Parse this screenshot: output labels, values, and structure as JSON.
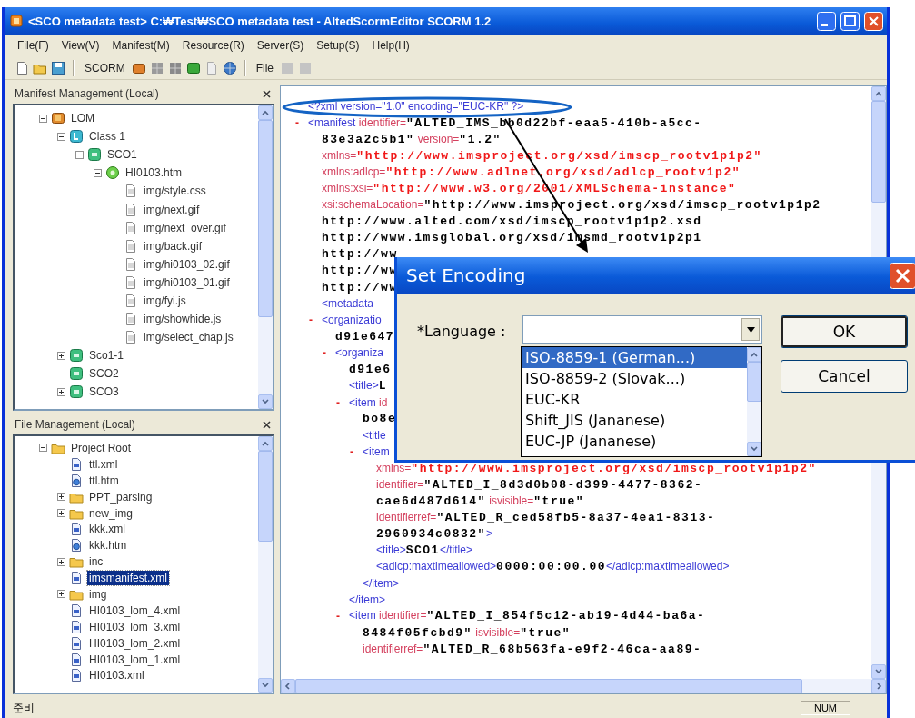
{
  "window": {
    "title": "<SCO metadata test> C:₩Test₩SCO metadata test - AltedScormEditor SCORM 1.2"
  },
  "menu": [
    "File(F)",
    "View(V)",
    "Manifest(M)",
    "Resource(R)",
    "Server(S)",
    "Setup(S)",
    "Help(H)"
  ],
  "toolbar": {
    "labels": [
      "SCORM",
      "File"
    ]
  },
  "manifest_tree": {
    "title": "Manifest Management (Local)",
    "items": [
      {
        "label": "LOM",
        "kind": "root",
        "expanded": true,
        "selected": false,
        "children": [
          {
            "label": "Class 1",
            "kind": "organization",
            "expanded": true,
            "selected": false,
            "children": [
              {
                "label": "SCO1",
                "kind": "sco",
                "expanded": true,
                "selected": false,
                "children": [
                  {
                    "label": "HI0103.htm",
                    "kind": "resource",
                    "expanded": true,
                    "selected": false,
                    "children": [
                      {
                        "label": "img/style.css",
                        "kind": "file",
                        "selected": false
                      },
                      {
                        "label": "img/next.gif",
                        "kind": "file",
                        "selected": false
                      },
                      {
                        "label": "img/next_over.gif",
                        "kind": "file",
                        "selected": false
                      },
                      {
                        "label": "img/back.gif",
                        "kind": "file",
                        "selected": false
                      },
                      {
                        "label": "img/hi0103_02.gif",
                        "kind": "file",
                        "selected": false
                      },
                      {
                        "label": "img/hi0103_01.gif",
                        "kind": "file",
                        "selected": false
                      },
                      {
                        "label": "img/fyi.js",
                        "kind": "file",
                        "selected": false
                      },
                      {
                        "label": "img/showhide.js",
                        "kind": "file",
                        "selected": false
                      },
                      {
                        "label": "img/select_chap.js",
                        "kind": "file",
                        "selected": false
                      }
                    ]
                  }
                ]
              }
            ]
          },
          {
            "label": "Sco1-1",
            "kind": "sco",
            "expanded": false,
            "selected": false
          },
          {
            "label": "SCO2",
            "kind": "sco",
            "selected": false
          },
          {
            "label": "SCO3",
            "kind": "sco",
            "expanded": false,
            "selected": false
          }
        ]
      }
    ]
  },
  "file_tree": {
    "title": "File Management (Local)",
    "items": [
      {
        "label": "Project Root",
        "kind": "folder",
        "expanded": true,
        "selected": false,
        "children": [
          {
            "label": "ttl.xml",
            "kind": "xml-file",
            "selected": false
          },
          {
            "label": "ttl.htm",
            "kind": "htm-file",
            "selected": false
          },
          {
            "label": "PPT_parsing",
            "kind": "folder",
            "expanded": false,
            "selected": false
          },
          {
            "label": "new_img",
            "kind": "folder",
            "expanded": false,
            "selected": false
          },
          {
            "label": "kkk.xml",
            "kind": "xml-file",
            "selected": false
          },
          {
            "label": "kkk.htm",
            "kind": "htm-file",
            "selected": false
          },
          {
            "label": "inc",
            "kind": "folder",
            "expanded": false,
            "selected": false
          },
          {
            "label": "imsmanifest.xml",
            "kind": "xml-file",
            "selected": true
          },
          {
            "label": "img",
            "kind": "folder",
            "expanded": false,
            "selected": false
          },
          {
            "label": "HI0103_lom_4.xml",
            "kind": "xml-file",
            "selected": false
          },
          {
            "label": "HI0103_lom_3.xml",
            "kind": "xml-file",
            "selected": false
          },
          {
            "label": "HI0103_lom_2.xml",
            "kind": "xml-file",
            "selected": false
          },
          {
            "label": "HI0103_lom_1.xml",
            "kind": "xml-file",
            "selected": false
          },
          {
            "label": "HI0103.xml",
            "kind": "xml-file",
            "selected": false
          }
        ]
      }
    ]
  },
  "editor": {
    "lines": [
      {
        "tokens": [
          {
            "kind": "tag",
            "text": "<?xml version=\"1.0\" encoding=\"EUC-KR\" ?>"
          }
        ]
      },
      {
        "marker": "-",
        "tokens": [
          {
            "kind": "tag",
            "text": "<manifest"
          },
          {
            "kind": "attr",
            "text": " identifier="
          },
          {
            "kind": "value",
            "text": "\"ALTED_IMS_bb0d22bf-eaa5-410b-a5cc-"
          }
        ],
        "children": [
          {
            "tokens": [
              {
                "kind": "value",
                "text": "83e3a2c5b1\""
              },
              {
                "kind": "attr",
                "text": " version="
              },
              {
                "kind": "value",
                "text": "\"1.2\""
              }
            ]
          },
          {
            "tokens": [
              {
                "kind": "attr",
                "text": "xmlns="
              },
              {
                "kind": "url",
                "text": "\"http://www.imsproject.org/xsd/imscp_rootv1p1p2\""
              }
            ]
          },
          {
            "tokens": [
              {
                "kind": "attr",
                "text": "xmlns:adlcp="
              },
              {
                "kind": "url",
                "text": "\"http://www.adlnet.org/xsd/adlcp_rootv1p2\""
              }
            ]
          },
          {
            "tokens": [
              {
                "kind": "attr",
                "text": "xmlns:xsi="
              },
              {
                "kind": "url",
                "text": "\"http://www.w3.org/2001/XMLSchema-instance\""
              }
            ]
          },
          {
            "tokens": [
              {
                "kind": "attr",
                "text": "xsi:schemaLocation="
              },
              {
                "kind": "value",
                "text": "\"http://www.imsproject.org/xsd/imscp_rootv1p1p2"
              }
            ]
          },
          {
            "tokens": [
              {
                "kind": "value",
                "text": "http://www.alted.com/xsd/imscp_rootv1p1p2.xsd"
              }
            ]
          },
          {
            "tokens": [
              {
                "kind": "value",
                "text": "http://www.imsglobal.org/xsd/imsmd_rootv1p2p1"
              }
            ]
          },
          {
            "tokens": [
              {
                "kind": "value",
                "text": "http://ww"
              }
            ]
          },
          {
            "tokens": [
              {
                "kind": "value",
                "text": "http://ww"
              }
            ]
          },
          {
            "tokens": [
              {
                "kind": "value",
                "text": "http://ww"
              }
            ]
          },
          {
            "tokens": [
              {
                "kind": "tag",
                "text": "<metadata"
              }
            ]
          },
          {
            "marker": "-",
            "tokens": [
              {
                "kind": "tag",
                "text": "<organizatio"
              }
            ],
            "children": [
              {
                "tokens": [
                  {
                    "kind": "value",
                    "text": "d91e647"
                  }
                ]
              },
              {
                "marker": "-",
                "tokens": [
                  {
                    "kind": "tag",
                    "text": "<organiza"
                  }
                ],
                "children": [
                  {
                    "tokens": [
                      {
                        "kind": "value",
                        "text": "d91e6"
                      }
                    ]
                  },
                  {
                    "tokens": [
                      {
                        "kind": "tag",
                        "text": "<title>"
                      },
                      {
                        "kind": "value",
                        "text": "L"
                      }
                    ]
                  },
                  {
                    "marker": "-",
                    "tokens": [
                      {
                        "kind": "tag",
                        "text": "<item"
                      },
                      {
                        "kind": "attr",
                        "text": " id"
                      }
                    ],
                    "children": [
                      {
                        "tokens": [
                          {
                            "kind": "value",
                            "text": "bo8e"
                          }
                        ]
                      },
                      {
                        "tokens": [
                          {
                            "kind": "tag",
                            "text": "<title"
                          }
                        ]
                      },
                      {
                        "marker": "-",
                        "tokens": [
                          {
                            "kind": "tag",
                            "text": "<item"
                          }
                        ],
                        "children": [
                          {
                            "tokens": [
                              {
                                "kind": "attr",
                                "text": "xmlns="
                              },
                              {
                                "kind": "url",
                                "text": "\"http://www.imsproject.org/xsd/imscp_rootv1p1p2\""
                              }
                            ]
                          },
                          {
                            "tokens": [
                              {
                                "kind": "attr",
                                "text": "identifier="
                              },
                              {
                                "kind": "value",
                                "text": "\"ALTED_I_8d3d0b08-d399-4477-8362-"
                              }
                            ]
                          },
                          {
                            "tokens": [
                              {
                                "kind": "value",
                                "text": "cae6d487d614\""
                              },
                              {
                                "kind": "attr",
                                "text": " isvisible="
                              },
                              {
                                "kind": "value",
                                "text": "\"true\""
                              }
                            ]
                          },
                          {
                            "tokens": [
                              {
                                "kind": "attr",
                                "text": "identifierref="
                              },
                              {
                                "kind": "value",
                                "text": "\"ALTED_R_ced58fb5-8a37-4ea1-8313-"
                              }
                            ]
                          },
                          {
                            "tokens": [
                              {
                                "kind": "value",
                                "text": "2960934c0832\""
                              },
                              {
                                "kind": "tag",
                                "text": ">"
                              }
                            ]
                          },
                          {
                            "tokens": [
                              {
                                "kind": "tag",
                                "text": "<title>"
                              },
                              {
                                "kind": "value",
                                "text": "SCO1"
                              },
                              {
                                "kind": "tag",
                                "text": "</title>"
                              }
                            ]
                          },
                          {
                            "tokens": [
                              {
                                "kind": "tag",
                                "text": "<adlcp:maxtimeallowed>"
                              },
                              {
                                "kind": "value",
                                "text": "0000:00:00.00"
                              },
                              {
                                "kind": "tag",
                                "text": "</adlcp:maxtimeallowed>"
                              }
                            ]
                          }
                        ]
                      },
                      {
                        "tokens": [
                          {
                            "kind": "tag",
                            "text": "</item>"
                          }
                        ]
                      }
                    ]
                  },
                  {
                    "tokens": [
                      {
                        "kind": "tag",
                        "text": "</item>"
                      }
                    ]
                  },
                  {
                    "marker": "-",
                    "tokens": [
                      {
                        "kind": "tag",
                        "text": "<item"
                      },
                      {
                        "kind": "attr",
                        "text": " identifier="
                      },
                      {
                        "kind": "value",
                        "text": "\"ALTED_I_854f5c12-ab19-4d44-ba6a-"
                      }
                    ],
                    "children": [
                      {
                        "tokens": [
                          {
                            "kind": "value",
                            "text": "8484f05fcbd9\""
                          },
                          {
                            "kind": "attr",
                            "text": " isvisible="
                          },
                          {
                            "kind": "value",
                            "text": "\"true\""
                          }
                        ]
                      },
                      {
                        "tokens": [
                          {
                            "kind": "attr",
                            "text": "identifierref="
                          },
                          {
                            "kind": "value",
                            "text": "\"ALTED_R_68b563fa-e9f2-46ca-aa89-"
                          }
                        ]
                      }
                    ]
                  }
                ]
              }
            ]
          }
        ]
      }
    ]
  },
  "status_bar": {
    "message": "준비",
    "indicator": "NUM"
  },
  "dialog": {
    "title": "Set Encoding",
    "label": "*Language :",
    "dropdown": {
      "expanded": true,
      "options": [
        {
          "label": "ISO-8859-1 (German...)",
          "selected": true
        },
        {
          "label": "ISO-8859-2 (Slovak...)",
          "selected": false
        },
        {
          "label": "EUC-KR",
          "selected": false
        },
        {
          "label": "Shift_JIS (Jananese)",
          "selected": false
        },
        {
          "label": "EUC-JP (Jananese)",
          "selected": false
        }
      ]
    },
    "buttons": [
      {
        "label": "OK",
        "default": true
      },
      {
        "label": "Cancel",
        "default": false
      }
    ]
  }
}
